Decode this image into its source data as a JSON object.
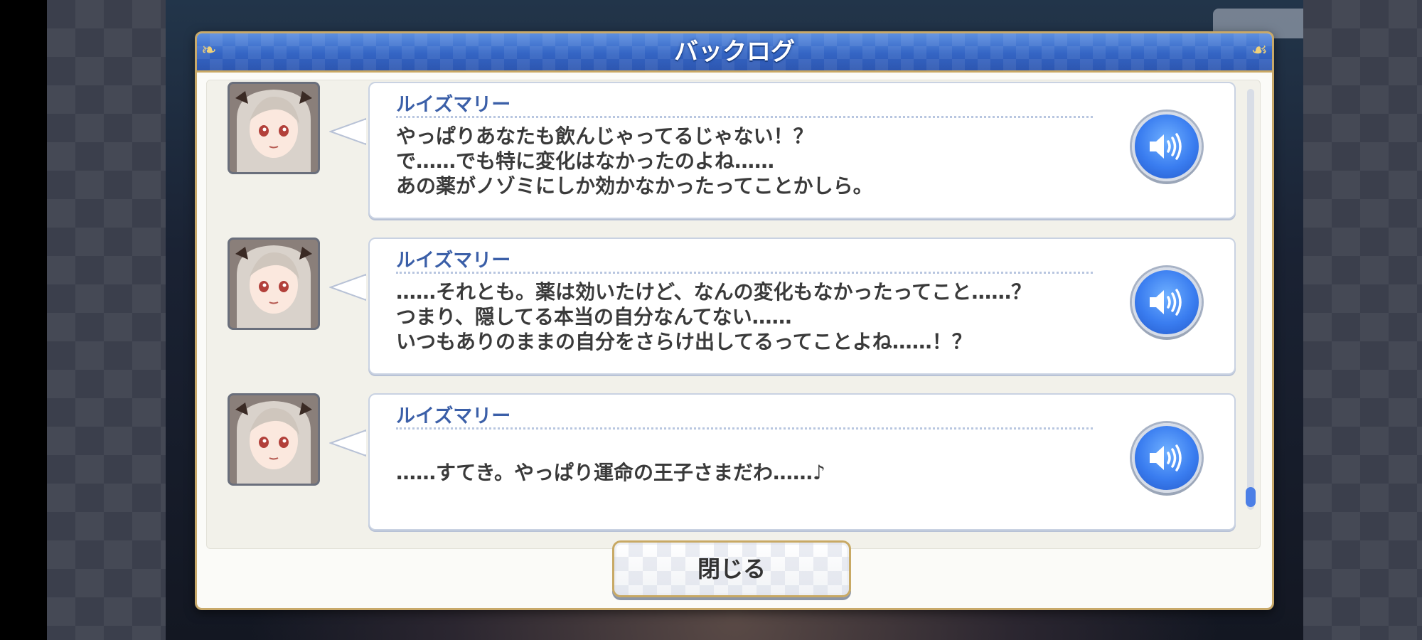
{
  "dialog": {
    "title": "バックログ",
    "close_label": "閉じる"
  },
  "entries": [
    {
      "speaker": "ルイズマリー",
      "lines": [
        "やっぱりあなたも飲んじゃってるじゃない！？",
        "で……でも特に変化はなかったのよね……",
        "あの薬がノゾミにしか効かなかったってことかしら。"
      ],
      "voice_icon": "speaker-icon"
    },
    {
      "speaker": "ルイズマリー",
      "lines": [
        "……それとも。薬は効いたけど、なんの変化もなかったってこと……？",
        "つまり、隠してる本当の自分なんてない……",
        "いつもありのままの自分をさらけ出してるってことよね……！？"
      ],
      "voice_icon": "speaker-icon"
    },
    {
      "speaker": "ルイズマリー",
      "lines": [
        "……すてき。やっぱり運命の王子さまだわ……♪"
      ],
      "voice_icon": "speaker-icon"
    }
  ],
  "scrollbar": {
    "position": "bottom"
  },
  "colors": {
    "header_blue": "#3465c4",
    "gold_border": "#c8a96a",
    "speaker_text": "#3b5fa8",
    "voice_button": "#3a7df0"
  }
}
